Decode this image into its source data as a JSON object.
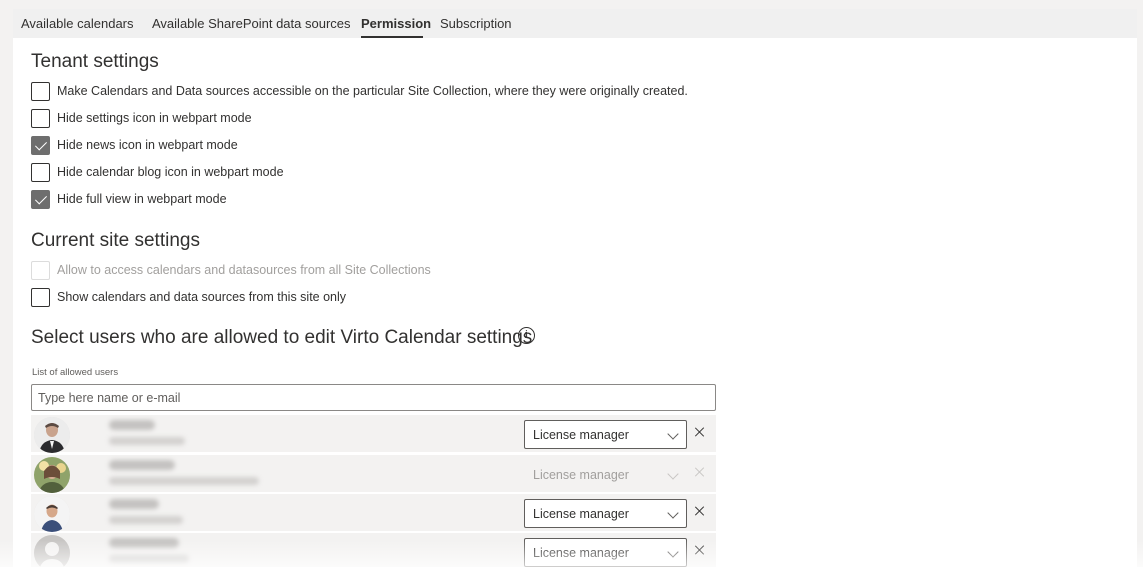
{
  "tabs": [
    {
      "label": "Available calendars"
    },
    {
      "label": "Available SharePoint data sources"
    },
    {
      "label": "Permission"
    },
    {
      "label": "Subscription"
    }
  ],
  "tenant": {
    "title": "Tenant settings",
    "options": [
      {
        "label": "Make Calendars and Data sources accessible on the particular Site Collection, where they were originally created.",
        "checked": false
      },
      {
        "label": "Hide settings icon in webpart mode",
        "checked": false
      },
      {
        "label": "Hide news icon in webpart mode",
        "checked": true
      },
      {
        "label": "Hide calendar blog icon in webpart mode",
        "checked": false
      },
      {
        "label": "Hide full view in webpart mode",
        "checked": true
      }
    ]
  },
  "site": {
    "title": "Current site settings",
    "options": [
      {
        "label": "Allow to access calendars and datasources from all Site Collections",
        "checked": false,
        "disabled": true
      },
      {
        "label": "Show calendars and data sources from this site only",
        "checked": false
      }
    ]
  },
  "users": {
    "title": "Select users who are allowed to edit Virto Calendar settings",
    "info_icon": "i",
    "field_label": "List of allowed users",
    "placeholder": "Type here name or e-mail",
    "items": [
      {
        "name": "Alexey Linnik",
        "email": "al@virtosoftware.com",
        "role": "License manager",
        "disabled": false
      },
      {
        "name": "Marina Conquest",
        "email": "Marina.Conquest@virtosoftware.com",
        "role": "License manager",
        "disabled": true
      },
      {
        "name": "Sergi Sinyugin",
        "email": "s@virtosoftware.com",
        "role": "License manager",
        "disabled": false
      },
      {
        "name": "Taras Malkhasyan",
        "email": "tm@virtosoftware.com",
        "role": "License manager",
        "disabled": false
      }
    ]
  }
}
